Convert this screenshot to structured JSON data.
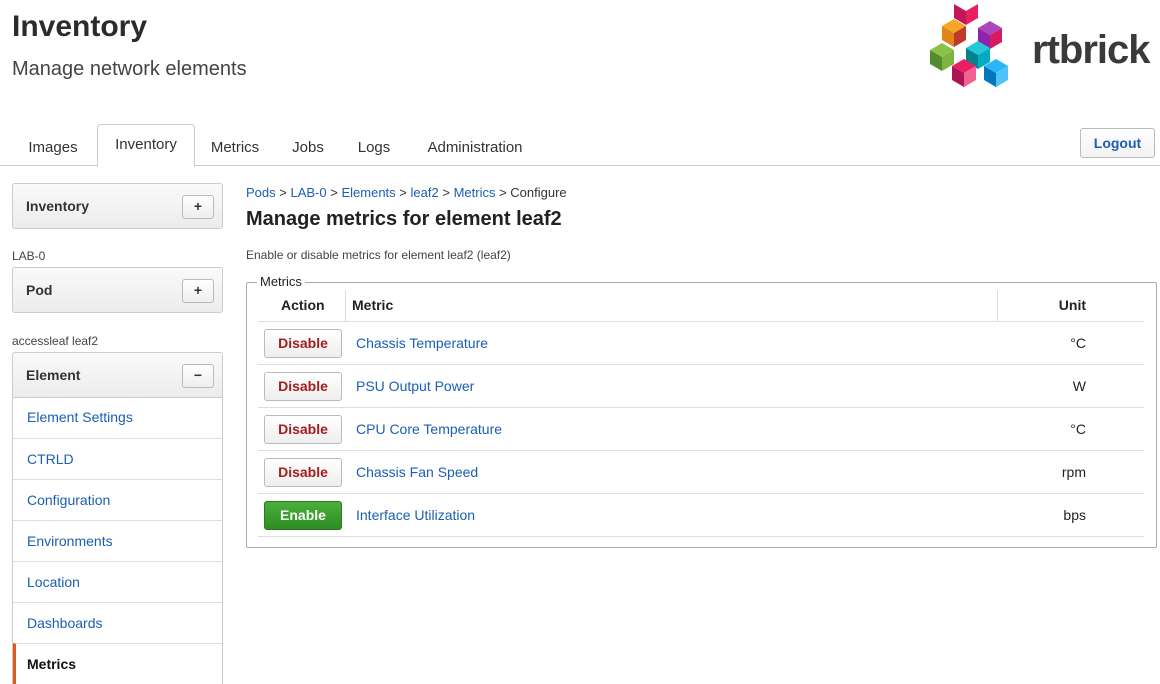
{
  "header": {
    "title": "Inventory",
    "subtitle": "Manage network elements",
    "logo_text": "rtbrick"
  },
  "nav": {
    "tabs": [
      {
        "label": "Images"
      },
      {
        "label": "Inventory",
        "active": true
      },
      {
        "label": "Metrics"
      },
      {
        "label": "Jobs"
      },
      {
        "label": "Logs"
      },
      {
        "label": "Administration"
      }
    ],
    "logout_label": "Logout"
  },
  "sidebar": {
    "inventory_panel": {
      "label": "Inventory",
      "button": "+"
    },
    "pod_caption": "LAB-0",
    "pod_panel": {
      "label": "Pod",
      "button": "+"
    },
    "element_caption": "accessleaf leaf2",
    "element_panel": {
      "label": "Element",
      "button": "−"
    },
    "items": [
      {
        "label": "Element Settings"
      },
      {
        "label": "CTRLD"
      },
      {
        "label": "Configuration"
      },
      {
        "label": "Environments"
      },
      {
        "label": "Location"
      },
      {
        "label": "Dashboards"
      },
      {
        "label": "Metrics",
        "active": true
      }
    ]
  },
  "main": {
    "breadcrumb": [
      {
        "label": "Pods",
        "link": true
      },
      {
        "label": "LAB-0",
        "link": true
      },
      {
        "label": "Elements",
        "link": true
      },
      {
        "label": "leaf2",
        "link": true
      },
      {
        "label": "Metrics",
        "link": true
      },
      {
        "label": "Configure",
        "link": false
      }
    ],
    "breadcrumb_separator": ">",
    "title": "Manage metrics for element leaf2",
    "description": "Enable or disable metrics for element leaf2 (leaf2)",
    "fieldset_legend": "Metrics",
    "table": {
      "headers": {
        "action": "Action",
        "metric": "Metric",
        "unit": "Unit"
      },
      "rows": [
        {
          "action": "Disable",
          "metric": "Chassis Temperature",
          "unit": "°C"
        },
        {
          "action": "Disable",
          "metric": "PSU Output Power",
          "unit": "W"
        },
        {
          "action": "Disable",
          "metric": "CPU Core Temperature",
          "unit": "°C"
        },
        {
          "action": "Disable",
          "metric": "Chassis Fan Speed",
          "unit": "rpm"
        },
        {
          "action": "Enable",
          "metric": "Interface Utilization",
          "unit": "bps"
        }
      ]
    }
  },
  "colors": {
    "link": "#1a5fb4",
    "disable_text": "#a51c1c",
    "enable_bg": "#2c8c22",
    "active_accent": "#e05a1c"
  }
}
